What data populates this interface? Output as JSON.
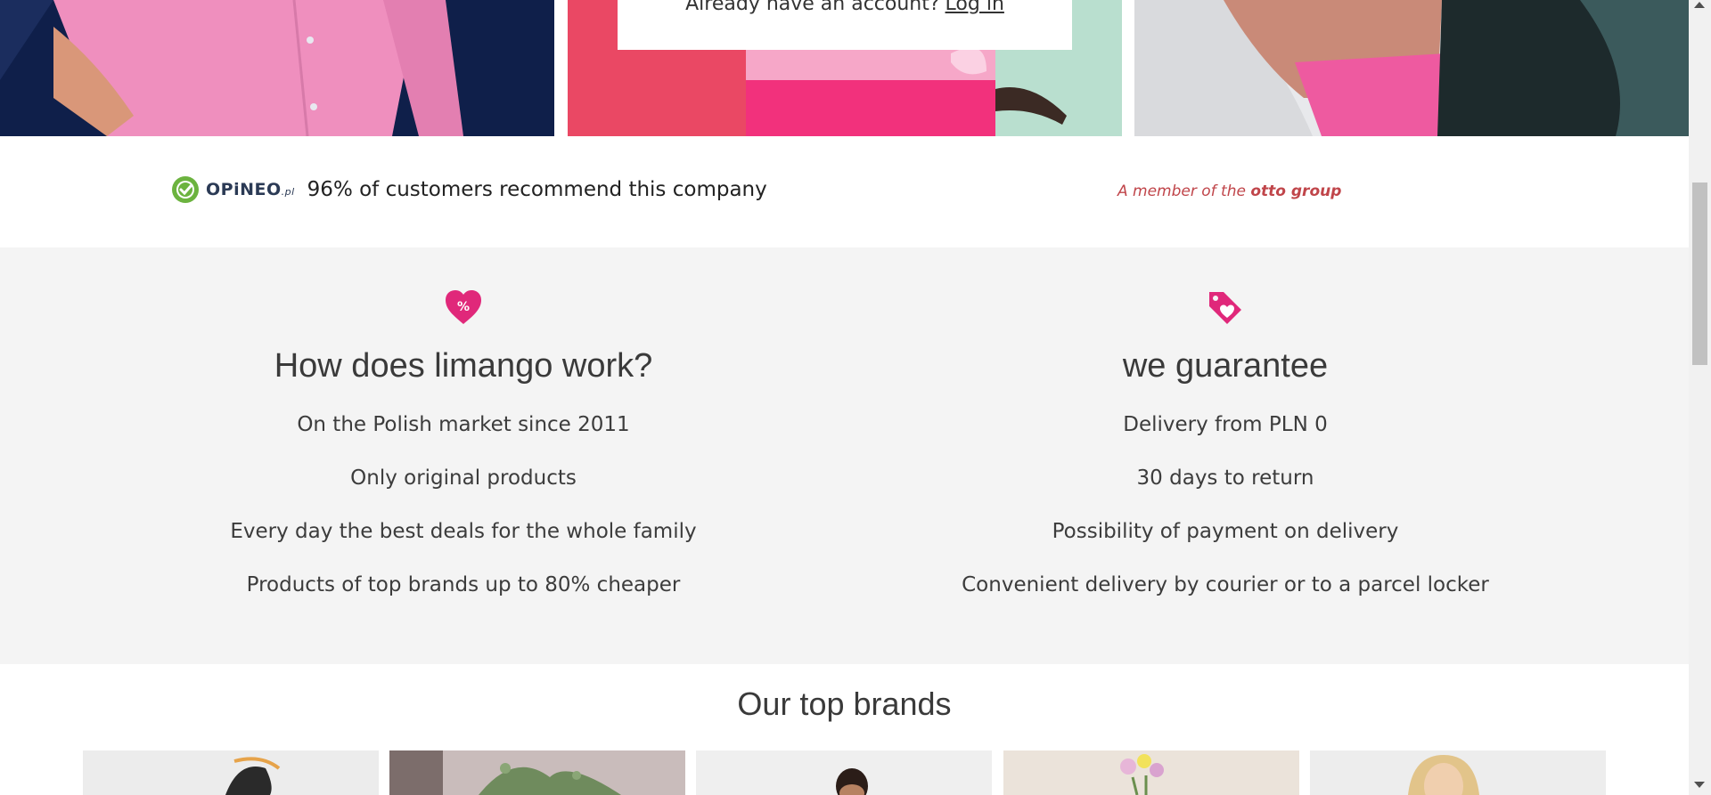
{
  "login_prompt": {
    "text": "Already have an account?",
    "link": "Log in"
  },
  "trust_bar": {
    "opineo_brand": "OPiNEO",
    "opineo_suffix": ".pl",
    "recommend_text": "96% of customers recommend this company",
    "member_prefix": "A member of the ",
    "member_group": "otto group"
  },
  "how_it_works": {
    "icon": "heart-percent-icon",
    "badge": "%",
    "title": "How does limango work?",
    "items": [
      "On the Polish market since 2011",
      "Only original products",
      "Every day the best deals for the whole family",
      "Products of top brands up to 80% cheaper"
    ]
  },
  "guarantee": {
    "icon": "tag-heart-icon",
    "title": "we guarantee",
    "items": [
      "Delivery from PLN 0",
      "30 days to return",
      "Possibility of payment on delivery",
      "Convenient delivery by courier or to a parcel locker"
    ]
  },
  "brands": {
    "title": "Our top brands"
  },
  "colors": {
    "accent_pink": "#e0287a",
    "opineo_green": "#6cb33f",
    "otto_red": "#c0454a",
    "section_gray": "#f4f4f4"
  }
}
